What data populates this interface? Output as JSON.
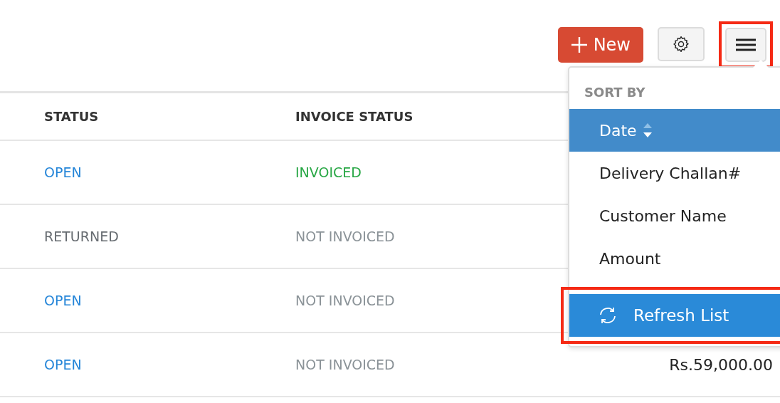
{
  "toolbar": {
    "new_button": {
      "label": "New"
    },
    "menu_button": {
      "highlighted": true
    }
  },
  "table": {
    "columns": [
      "STATUS",
      "INVOICE STATUS"
    ],
    "rows": [
      {
        "status": {
          "text": "OPEN",
          "color": "#2485d8"
        },
        "invoice_status": {
          "text": "INVOICED",
          "color": "#28a745"
        }
      },
      {
        "status": {
          "text": "RETURNED",
          "color": "#666b70"
        },
        "invoice_status": {
          "text": "NOT INVOICED",
          "color": "#8a9297"
        }
      },
      {
        "status": {
          "text": "OPEN",
          "color": "#2485d8"
        },
        "invoice_status": {
          "text": "NOT INVOICED",
          "color": "#8a9297"
        }
      },
      {
        "status": {
          "text": "OPEN",
          "color": "#2485d8"
        },
        "invoice_status": {
          "text": "NOT INVOICED",
          "color": "#8a9297"
        },
        "amount": "Rs.59,000.00"
      }
    ]
  },
  "dropdown": {
    "heading": "SORT BY",
    "items": [
      {
        "label": "Date",
        "selected": true
      },
      {
        "label": "Delivery Challan#",
        "selected": false
      },
      {
        "label": "Customer Name",
        "selected": false
      },
      {
        "label": "Amount",
        "selected": false
      }
    ],
    "refresh": {
      "label": "Refresh List",
      "highlighted": true
    }
  }
}
